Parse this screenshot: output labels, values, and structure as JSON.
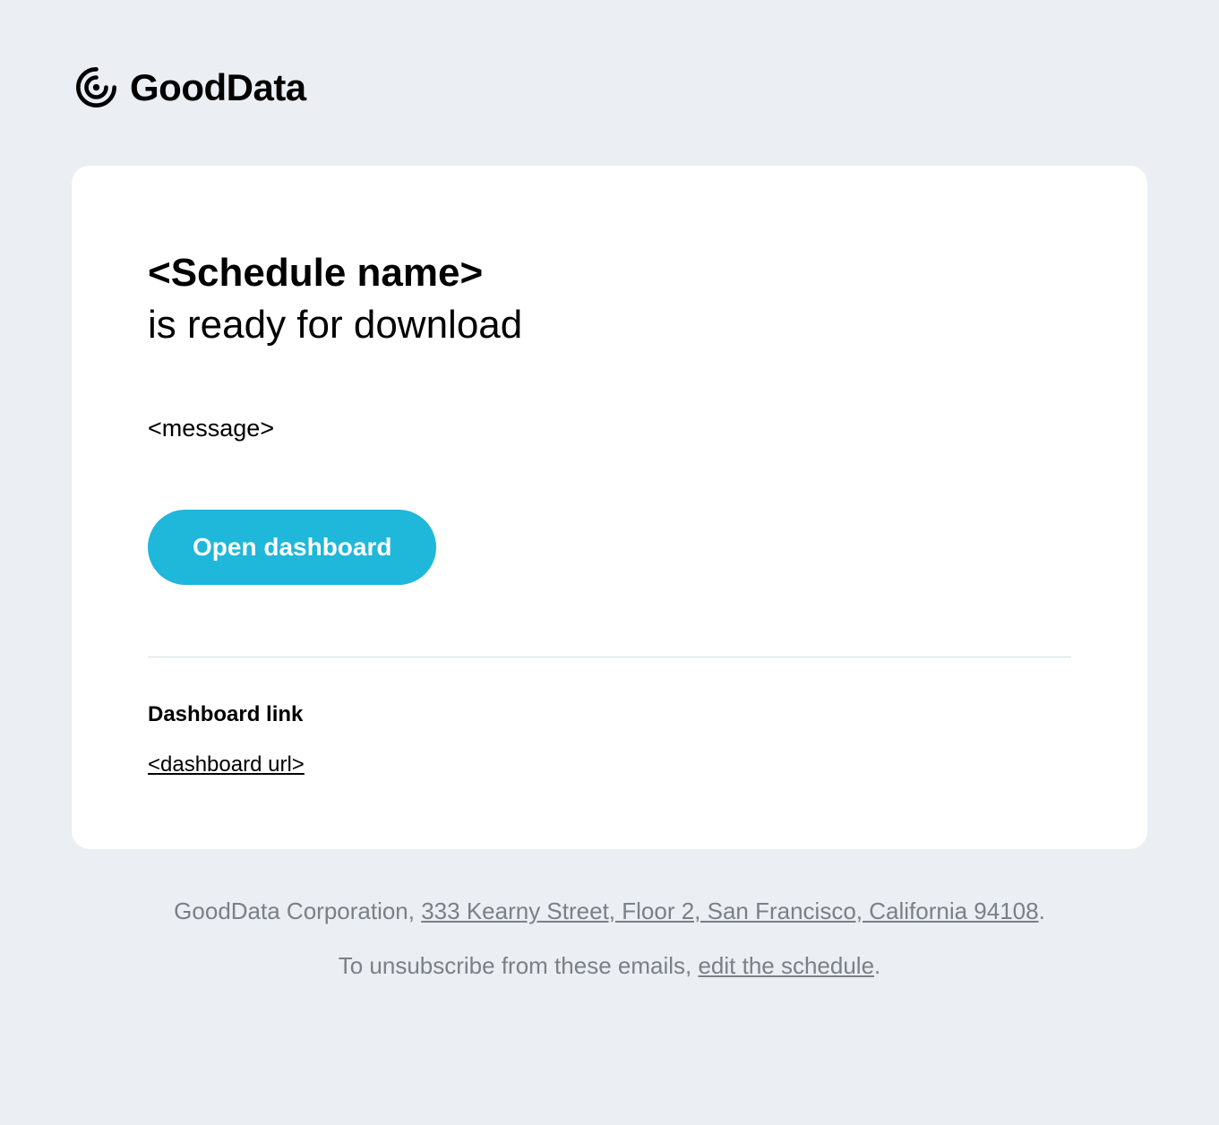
{
  "logo": {
    "text": "GoodData"
  },
  "card": {
    "schedule_name": "<Schedule name>",
    "ready_text": "is ready for download",
    "message": "<message>",
    "button_label": "Open dashboard",
    "dashboard_link_label": "Dashboard link",
    "dashboard_url": "<dashboard url>"
  },
  "footer": {
    "company_prefix": "GoodData Corporation, ",
    "address": "333 Kearny Street, Floor 2, San Francisco, California 94108",
    "address_suffix": ".",
    "unsubscribe_prefix": "To unsubscribe from these emails, ",
    "unsubscribe_link": "edit the schedule",
    "unsubscribe_suffix": "."
  }
}
